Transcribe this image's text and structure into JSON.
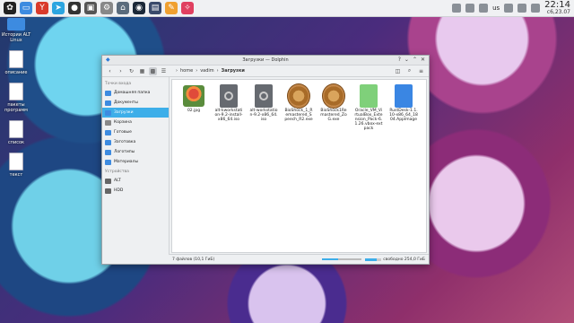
{
  "panel": {
    "keyboard_layout": "us",
    "time": "22:14",
    "date": "c6,23.07"
  },
  "desktop": {
    "icons": [
      {
        "label": "Истории ALT Linux",
        "icon": "folder-icon"
      },
      {
        "label": "описание",
        "icon": "document-icon"
      },
      {
        "label": "пакеты программ",
        "icon": "document-icon"
      },
      {
        "label": "список",
        "icon": "document-icon"
      },
      {
        "label": "текст",
        "icon": "document-icon"
      }
    ]
  },
  "window": {
    "title": "Загрузки — Dolphin",
    "breadcrumb": [
      "home",
      "vadim",
      "Загрузки"
    ],
    "sidebar": {
      "sections": [
        {
          "title": "Точки входа",
          "items": [
            {
              "label": "Домашняя папка",
              "icon": "home-icon",
              "selected": false
            },
            {
              "label": "Документы",
              "icon": "folder-icon",
              "selected": false
            },
            {
              "label": "Загрузки",
              "icon": "download-folder-icon",
              "selected": true
            },
            {
              "label": "Корзина",
              "icon": "trash-icon",
              "selected": false
            },
            {
              "label": "Готовые",
              "icon": "folder-icon",
              "selected": false
            },
            {
              "label": "Заготовка",
              "icon": "folder-icon",
              "selected": false
            },
            {
              "label": "Логотипы",
              "icon": "folder-icon",
              "selected": false
            },
            {
              "label": "Материалы",
              "icon": "folder-icon",
              "selected": false
            }
          ]
        },
        {
          "title": "Устройства",
          "items": [
            {
              "label": "ALT",
              "icon": "drive-icon",
              "selected": false
            },
            {
              "label": "HDD",
              "icon": "drive-icon",
              "selected": false
            }
          ]
        }
      ]
    },
    "files": [
      {
        "name": "02.jpg",
        "type": "image"
      },
      {
        "name": "alt-kworkstation-9.2-install-x86_64.iso",
        "type": "iso"
      },
      {
        "name": "alt-workstation-9.2-x86_64.iso",
        "type": "iso"
      },
      {
        "name": "BioShock_1_Remastered_Speech_R2.exe",
        "type": "exe"
      },
      {
        "name": "BioShock1Remastered_ZoG.exe",
        "type": "exe"
      },
      {
        "name": "Oracle_VM_VirtualBox_Extension_Pack-6.1.26.vbox-extpack",
        "type": "vbox"
      },
      {
        "name": "RustDesk-1.1.10-x86_64_1804.AppImage",
        "type": "appimage"
      }
    ],
    "status": {
      "summary": "7 файлов (10,1 ГиБ)",
      "free_space": "свободно 254,0 ГиБ",
      "zoom_level": 0.4,
      "disk_used": 0.7
    }
  }
}
